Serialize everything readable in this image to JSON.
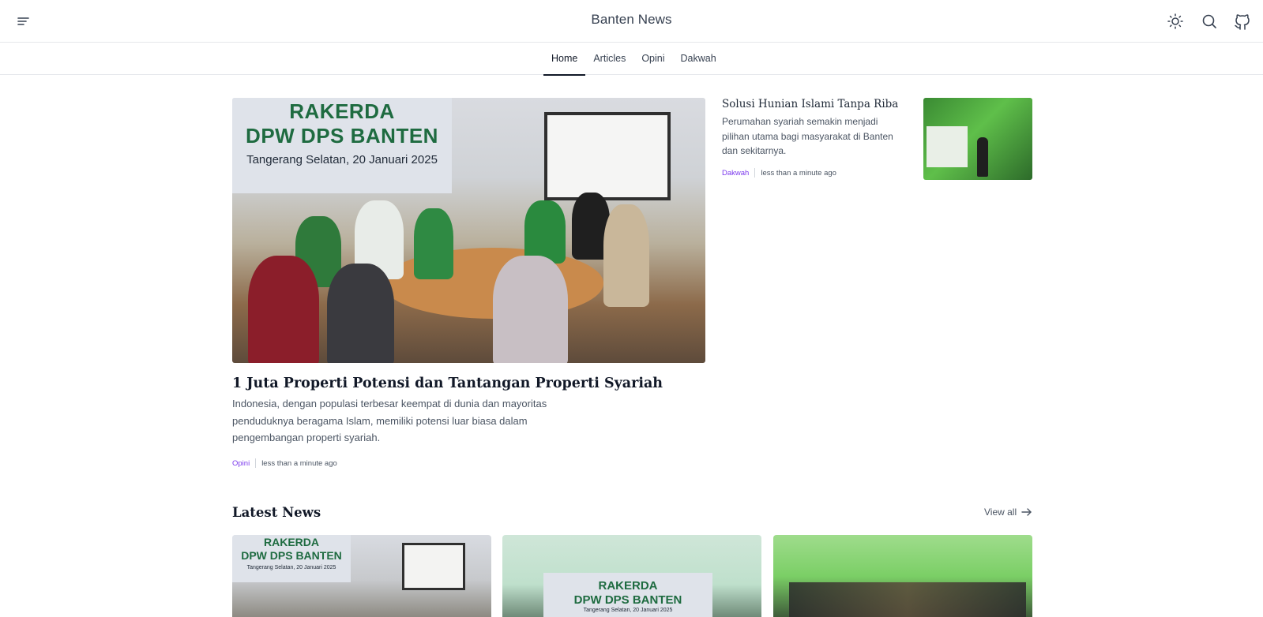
{
  "header": {
    "title": "Banten News",
    "icons": [
      "menu-icon",
      "sun-icon",
      "search-icon",
      "github-icon"
    ]
  },
  "nav": {
    "tabs": [
      {
        "label": "Home",
        "active": true
      },
      {
        "label": "Articles",
        "active": false
      },
      {
        "label": "Opini",
        "active": false
      },
      {
        "label": "Dakwah",
        "active": false
      }
    ]
  },
  "hero": {
    "banner_line1": "RAKERDA",
    "banner_line2": "DPW DPS BANTEN",
    "banner_line3": "Tangerang Selatan, 20 Januari 2025",
    "title": "1 Juta Properti Potensi dan Tantangan Properti Syariah",
    "description": "Indonesia, dengan populasi terbesar keempat di dunia dan mayoritas penduduknya beragama Islam, memiliki potensi luar biasa dalam pengembangan properti syariah.",
    "category": "Opini",
    "time": "less than a minute ago"
  },
  "side_article": {
    "title": "Solusi Hunian Islami Tanpa Riba",
    "description": "Perumahan syariah semakin menjadi pilihan utama bagi masyarakat di Banten dan sekitarnya.",
    "category": "Dakwah",
    "time": "less than a minute ago"
  },
  "latest": {
    "heading": "Latest News",
    "view_all": "View all",
    "cards": [
      {
        "banner_line1": "RAKERDA",
        "banner_line2": "DPW DPS BANTEN",
        "banner_line3": "Tangerang Selatan, 20 Januari 2025"
      },
      {
        "banner_line1": "RAKERDA",
        "banner_line2": "DPW DPS BANTEN",
        "banner_line3": "Tangerang Selatan, 20 Januari 2025"
      },
      {}
    ]
  },
  "colors": {
    "accent_category": "#7c3aed",
    "border": "#e5e7eb",
    "banner_green": "#1e6b40"
  }
}
